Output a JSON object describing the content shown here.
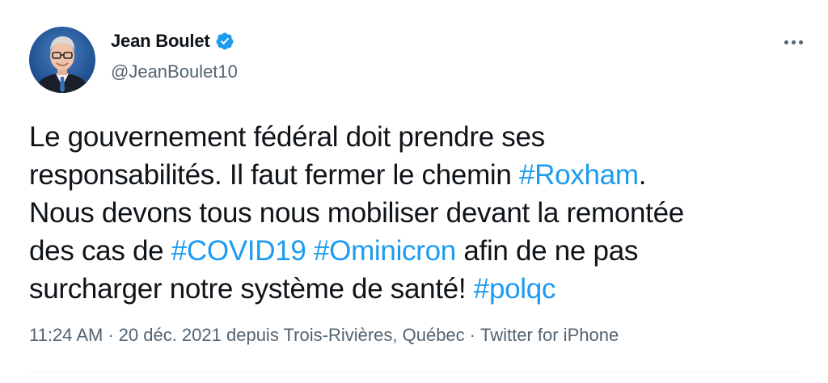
{
  "author": {
    "display_name": "Jean Boulet",
    "handle": "@JeanBoulet10",
    "verified_icon": "verified-badge-icon",
    "verified_color": "#1d9bf0"
  },
  "more_icon": "more-horizontal-icon",
  "tweet": {
    "lines": [
      [
        {
          "text": "Le gouvernement fédéral doit prendre ses"
        }
      ],
      [
        {
          "text": "responsabilités. Il faut fermer le chemin "
        },
        {
          "text": "#Roxham",
          "hashtag": true
        },
        {
          "text": "."
        }
      ],
      [
        {
          "text": "Nous devons tous nous mobiliser devant la remontée"
        }
      ],
      [
        {
          "text": "des cas de "
        },
        {
          "text": "#COVID19",
          "hashtag": true
        },
        {
          "text": " "
        },
        {
          "text": "#Ominicron",
          "hashtag": true
        },
        {
          "text": " afin de ne pas"
        }
      ],
      [
        {
          "text": "surcharger notre système de santé! "
        },
        {
          "text": "#polqc",
          "hashtag": true
        }
      ]
    ]
  },
  "meta": {
    "time": "11:24 AM",
    "date_location": "20 déc. 2021 depuis Trois-Rivières, Québec",
    "separator": "·",
    "source": "Twitter for iPhone"
  },
  "colors": {
    "text": "#0f1419",
    "secondary": "#536471",
    "link": "#1d9bf0"
  }
}
